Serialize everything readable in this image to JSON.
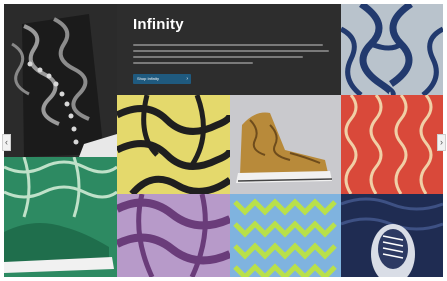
{
  "banner": {
    "title": "Infinity",
    "button_label": "Shop Infinity",
    "button_icon": "chevron-right-icon"
  },
  "carousel": {
    "prev_icon": "chevron-left-icon",
    "prev_glyph": "‹",
    "next_icon": "chevron-right-icon",
    "next_glyph": "›"
  },
  "colors": {
    "banner_bg": "#2d2d2d",
    "button": "#1f5a7f",
    "tile_blue": "#b9c3cc",
    "tile_yellow": "#e4d96c",
    "tile_red": "#d9493a",
    "tile_green": "#2d8a62",
    "tile_purple": "#b79ac9",
    "tile_lime": "#7fb3df",
    "tile_navy": "#1f2c52"
  }
}
